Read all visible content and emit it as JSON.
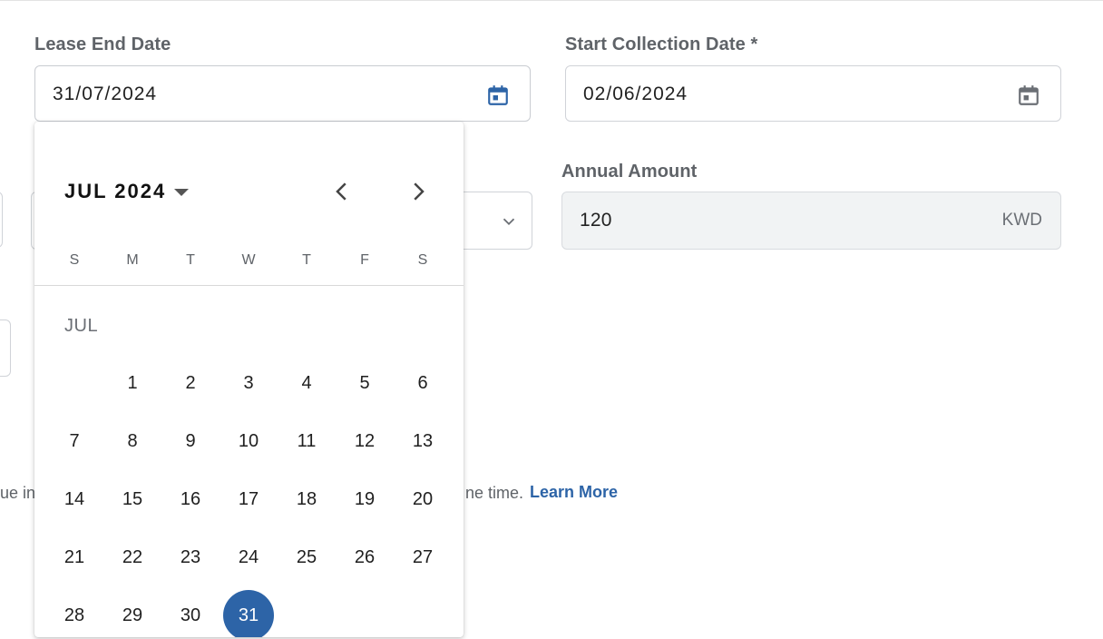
{
  "lease_end": {
    "label": "Lease End Date",
    "value": "31/07/2024"
  },
  "start_collection": {
    "label": "Start Collection Date *",
    "value": "02/06/2024"
  },
  "annual_amount": {
    "label": "Annual Amount",
    "value": "120",
    "currency": "KWD"
  },
  "helper": {
    "text_left": "ue in",
    "text_right": "ne time.",
    "link": "Learn More"
  },
  "calendar": {
    "month_year": "JUL 2024",
    "month_label": "JUL",
    "weekdays": [
      "S",
      "M",
      "T",
      "W",
      "T",
      "F",
      "S"
    ],
    "first_weekday_index": 1,
    "days_in_month": 31,
    "selected_day": 31
  },
  "colors": {
    "accent": "#2d64a7",
    "label": "#5f6368"
  },
  "icons": {
    "lease_end_calendar": "calendar-icon",
    "start_collection_calendar": "calendar-icon",
    "prev_month": "chevron-left-icon",
    "next_month": "chevron-right-icon",
    "dropdown": "chevron-down-icon"
  }
}
